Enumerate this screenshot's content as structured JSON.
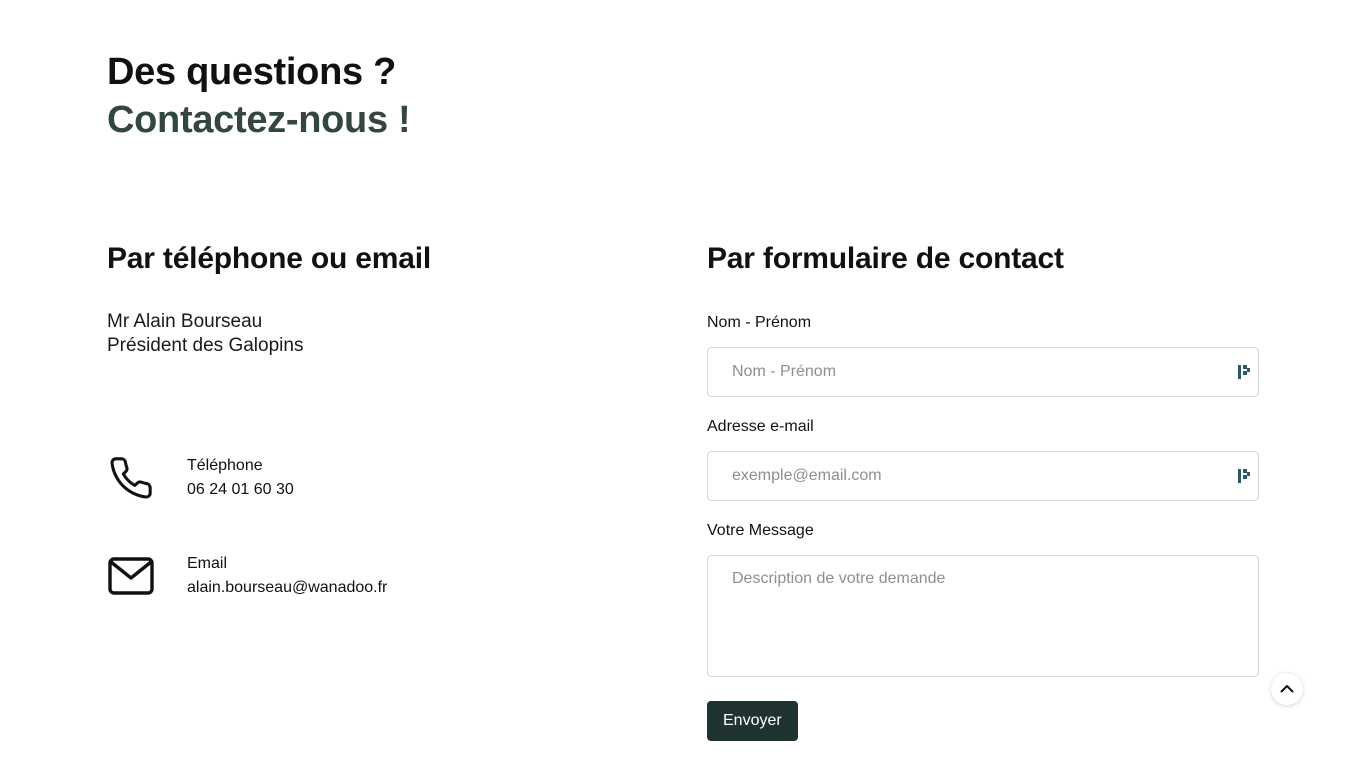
{
  "heading": {
    "line1": "Des questions ?",
    "line2": "Contactez-nous !",
    "line2_color": "#334740"
  },
  "left": {
    "title": "Par téléphone ou email",
    "person_name": "Mr Alain Bourseau",
    "person_role": "Président des Galopins",
    "phone": {
      "icon": "phone-icon",
      "label": "Téléphone",
      "value": "06 24 01 60 30"
    },
    "email": {
      "icon": "mail-icon",
      "label": "Email",
      "value": "alain.bourseau@wanadoo.fr"
    }
  },
  "form": {
    "title": "Par formulaire de contact",
    "name_label": "Nom - Prénom",
    "name_placeholder": "Nom - Prénom",
    "name_value": "",
    "email_label": "Adresse e-mail",
    "email_placeholder": "exemple@email.com",
    "email_value": "",
    "message_label": "Votre Message",
    "message_placeholder": "Description de votre demande",
    "message_value": "",
    "submit_label": "Envoyer",
    "submit_color": "#1f3330",
    "field_icon": "password-manager-icon"
  },
  "scroll_top": {
    "icon": "chevron-up-icon"
  }
}
